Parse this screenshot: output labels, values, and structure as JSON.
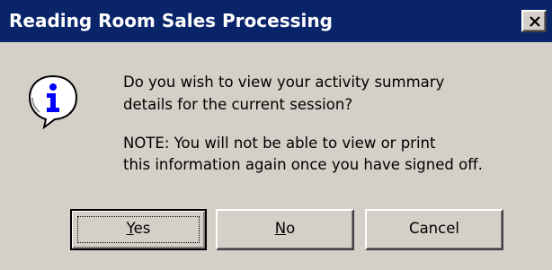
{
  "window": {
    "title": "Reading Room Sales Processing",
    "close_glyph": "×"
  },
  "icon": "info-icon",
  "message": {
    "line1": "Do you wish to view your activity summary",
    "line2": "details for the current session?",
    "line3": "NOTE: You will not be able to view or print",
    "line4": "this information again once you have signed off."
  },
  "buttons": {
    "yes": {
      "label": "Yes",
      "mnemonic": "Y",
      "rest": "es"
    },
    "no": {
      "label": "No",
      "mnemonic": "N",
      "rest": "o"
    },
    "cancel": {
      "label": "Cancel"
    }
  },
  "colors": {
    "titlebar": "#0a246a",
    "dialog_bg": "#d4d0c8",
    "icon_blue": "#0000ff"
  }
}
